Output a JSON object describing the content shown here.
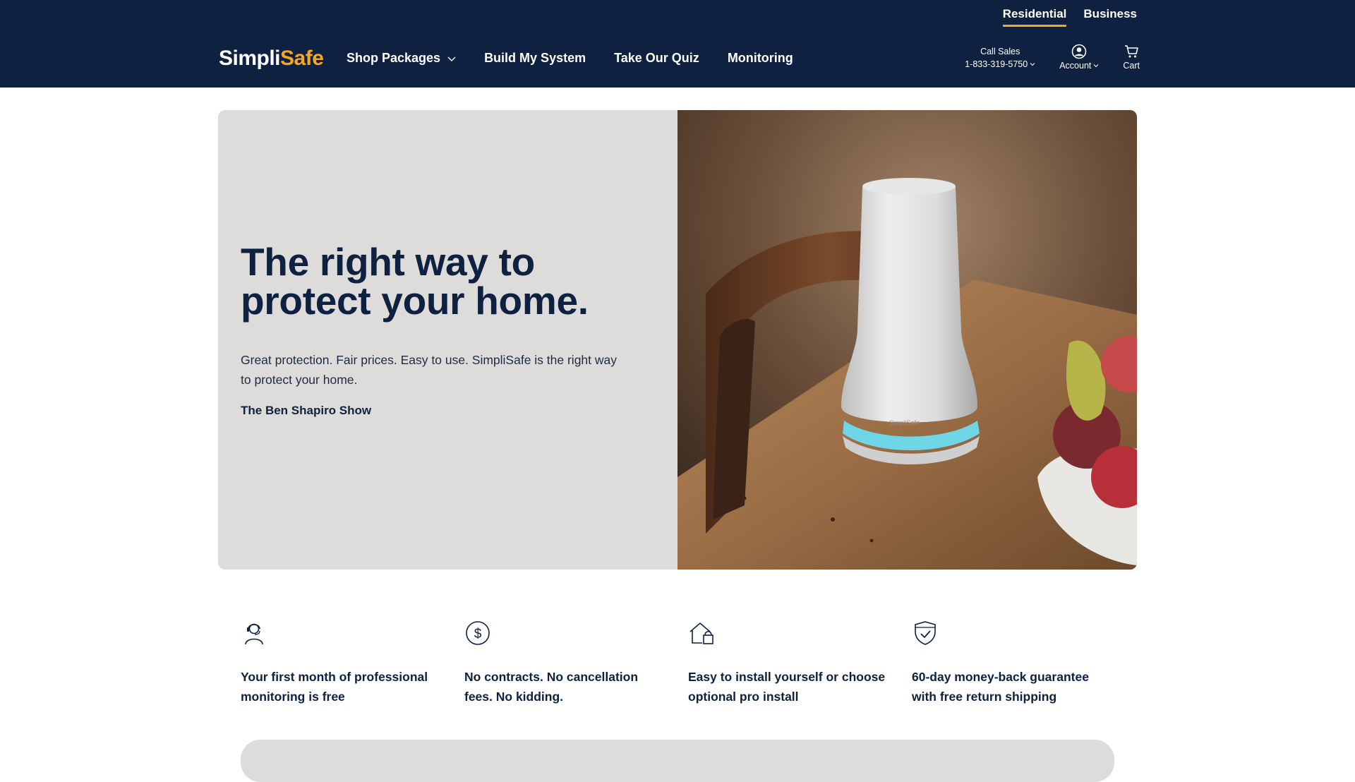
{
  "header": {
    "segments": [
      {
        "label": "Residential",
        "active": true
      },
      {
        "label": "Business",
        "active": false
      }
    ],
    "logo": {
      "part1": "Simpli",
      "part2": "Safe"
    },
    "nav": [
      {
        "label": "Shop Packages",
        "has_dropdown": true
      },
      {
        "label": "Build My System"
      },
      {
        "label": "Take Our Quiz"
      },
      {
        "label": "Monitoring"
      }
    ],
    "call_sales": {
      "label": "Call Sales",
      "phone": "1-833-319-5750"
    },
    "account_label": "Account",
    "cart_label": "Cart"
  },
  "hero": {
    "title_line1": "The right way to",
    "title_line2": "protect your home.",
    "body": "Great protection. Fair prices. Easy to use. SimpliSafe is the right way to protect your home.",
    "source": "The Ben Shapiro Show",
    "image_device_text": "SimpliSafe"
  },
  "benefits": [
    {
      "icon": "headset-agent-icon",
      "text": "Your first month of professional monitoring is free"
    },
    {
      "icon": "dollar-circle-icon",
      "text": "No contracts. No cancellation fees. No kidding."
    },
    {
      "icon": "house-install-icon",
      "text": "Easy to install yourself or choose optional pro install"
    },
    {
      "icon": "shield-check-icon",
      "text": "60-day money-back guarantee with free return shipping"
    }
  ],
  "colors": {
    "navy": "#0f2140",
    "accent_orange": "#f5a623",
    "hero_panel": "#dedcdb",
    "base_station_glow": "#6fd6e8"
  }
}
